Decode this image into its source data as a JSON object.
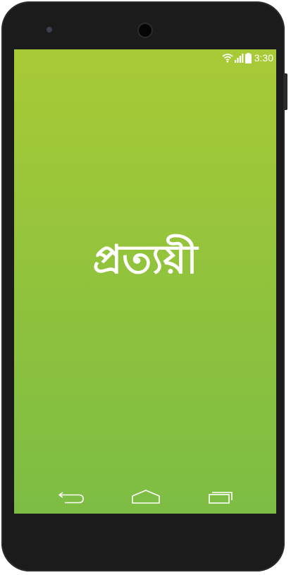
{
  "status_bar": {
    "time": "3:30",
    "icons": [
      "wifi-icon",
      "signal-icon",
      "battery-icon"
    ]
  },
  "splash": {
    "app_name": "প্রত্যয়ী"
  },
  "navigation": {
    "buttons": [
      "back-icon",
      "home-icon",
      "recent-apps-icon"
    ]
  },
  "colors": {
    "phone_body": "#1b1b1b",
    "screen_top": "#a8ca37",
    "screen_bottom": "#7dbd44",
    "foreground": "#ffffff"
  }
}
